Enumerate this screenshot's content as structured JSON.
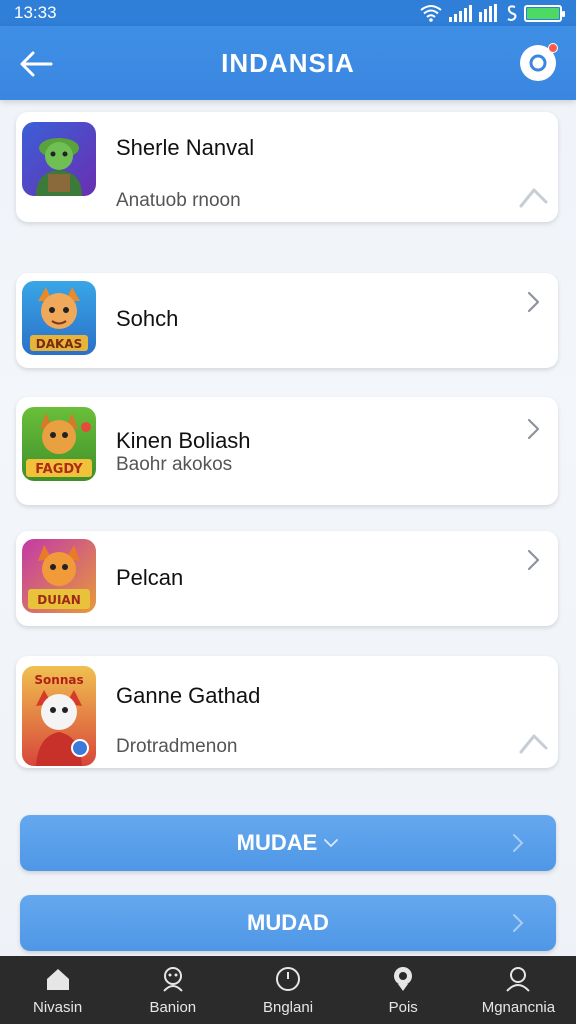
{
  "status": {
    "time": "13:33"
  },
  "header": {
    "title": "INDANSIA"
  },
  "games": [
    {
      "title": "Sherle Nanval",
      "subtitle": "Anatuob rnoon",
      "thumb_text": ""
    },
    {
      "title": "Sohch",
      "subtitle": "",
      "thumb_text": "DAKAS"
    },
    {
      "title": "Kinen Boliash",
      "subtitle": "Baohr akokos",
      "thumb_text": "FAGDY"
    },
    {
      "title": "Pelcan",
      "subtitle": "",
      "thumb_text": "DUIAN"
    },
    {
      "title": "Ganne Gathad",
      "subtitle": "Drotradmenon",
      "thumb_text": "Sonnas"
    }
  ],
  "buttons": {
    "primary_label": "MUDAE",
    "secondary_label": "MUDAD"
  },
  "nav": [
    {
      "label": "Nivasin",
      "icon": "home-icon"
    },
    {
      "label": "Banion",
      "icon": "community-icon"
    },
    {
      "label": "Bnglani",
      "icon": "clock-icon"
    },
    {
      "label": "Pois",
      "icon": "location-icon"
    },
    {
      "label": "Mgnancnia",
      "icon": "profile-icon"
    }
  ],
  "colors": {
    "accent": "#3a86e0",
    "button": "#5a9fea",
    "nav_bg": "#2b2b2b",
    "notification": "#ff5a4a"
  }
}
